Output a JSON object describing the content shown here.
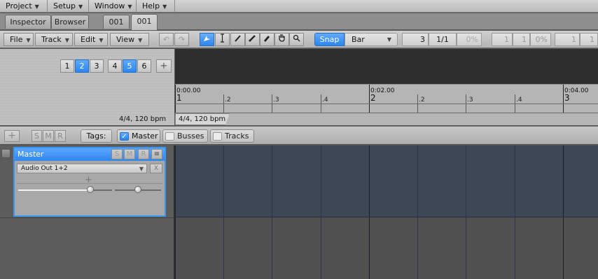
{
  "menu": [
    "Project",
    "Setup",
    "Window",
    "Help"
  ],
  "tabs": {
    "inspector": "Inspector",
    "browser": "Browser",
    "doc1": "001",
    "doc2": "001"
  },
  "toolbar": {
    "file": "File",
    "track": "Track",
    "edit": "Edit",
    "view": "View",
    "tools": [
      "arrow-tool",
      "ibeam-tool",
      "pencil-tool",
      "brush-tool",
      "marker-tool",
      "hand-tool",
      "zoom-tool"
    ],
    "snap": "Snap",
    "grid": "Bar",
    "pos_bar": "3",
    "time_sig": "1/1",
    "percent": "0%",
    "right_fields": [
      "1",
      "1",
      "0%",
      "1",
      "1"
    ]
  },
  "layers": [
    "1",
    "2",
    "3",
    "4",
    "5",
    "6"
  ],
  "layers_active": [
    "2",
    "5"
  ],
  "tempo_label": "4/4, 120 bpm",
  "ruler": {
    "times": [
      "0:00.00",
      "0:02.00",
      "0:04.00"
    ],
    "bars": [
      "1",
      "2",
      "3"
    ],
    "subs": [
      ".2",
      ".3",
      ".4"
    ],
    "tempo_marker": "4/4, 120 bpm"
  },
  "tagsbar": {
    "s": "S",
    "m": "M",
    "r": "R",
    "tags_label": "Tags:",
    "tags": [
      {
        "label": "Master",
        "checked": true
      },
      {
        "label": "Busses",
        "checked": false
      },
      {
        "label": "Tracks",
        "checked": false
      }
    ]
  },
  "master": {
    "name": "Master",
    "s": "S",
    "m": "M",
    "r": "R",
    "output": "Audio Out 1+2",
    "x": "X",
    "volume": 0.77,
    "pan": 0.5
  },
  "colors": {
    "accent": "#3a96f2",
    "track_area": "#3d4756",
    "empty_area": "#505050"
  }
}
